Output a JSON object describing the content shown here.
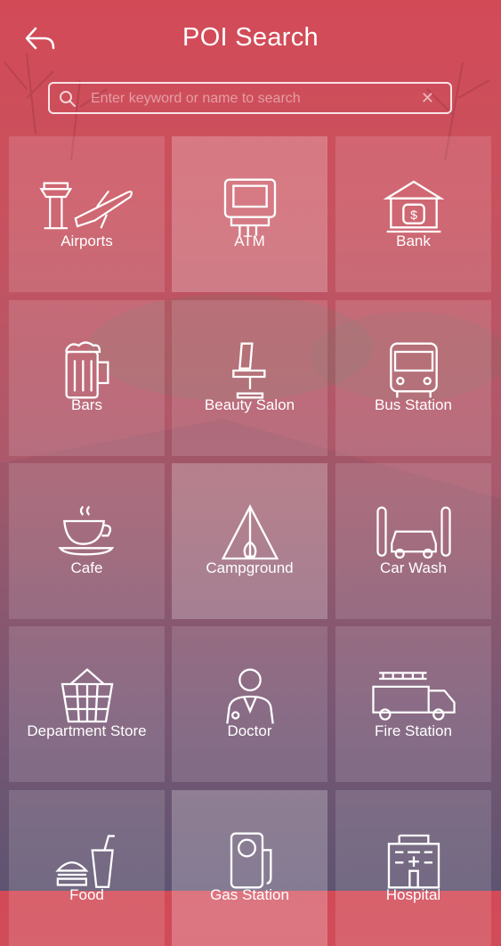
{
  "header": {
    "title": "POI Search",
    "back_icon": "back-arrow-icon"
  },
  "search": {
    "placeholder": "Enter keyword or name to search",
    "value": "",
    "clear_label": "✕"
  },
  "categories": [
    {
      "label": "Airports",
      "icon": "airport-icon"
    },
    {
      "label": "ATM",
      "icon": "atm-icon"
    },
    {
      "label": "Bank",
      "icon": "bank-icon"
    },
    {
      "label": "Bars",
      "icon": "beer-mug-icon"
    },
    {
      "label": "Beauty Salon",
      "icon": "salon-chair-icon"
    },
    {
      "label": "Bus Station",
      "icon": "bus-icon"
    },
    {
      "label": "Cafe",
      "icon": "coffee-cup-icon"
    },
    {
      "label": "Campground",
      "icon": "tent-icon"
    },
    {
      "label": "Car Wash",
      "icon": "car-wash-icon"
    },
    {
      "label": "Department Store",
      "icon": "basket-icon"
    },
    {
      "label": "Doctor",
      "icon": "doctor-icon"
    },
    {
      "label": "Fire Station",
      "icon": "fire-truck-icon"
    },
    {
      "label": "Food",
      "icon": "burger-drink-icon"
    },
    {
      "label": "Gas Station",
      "icon": "gas-pump-icon"
    },
    {
      "label": "Hospital",
      "icon": "hospital-icon"
    }
  ],
  "colors": {
    "gradient_top": "#d34a57",
    "gradient_bottom": "#5f5675"
  }
}
